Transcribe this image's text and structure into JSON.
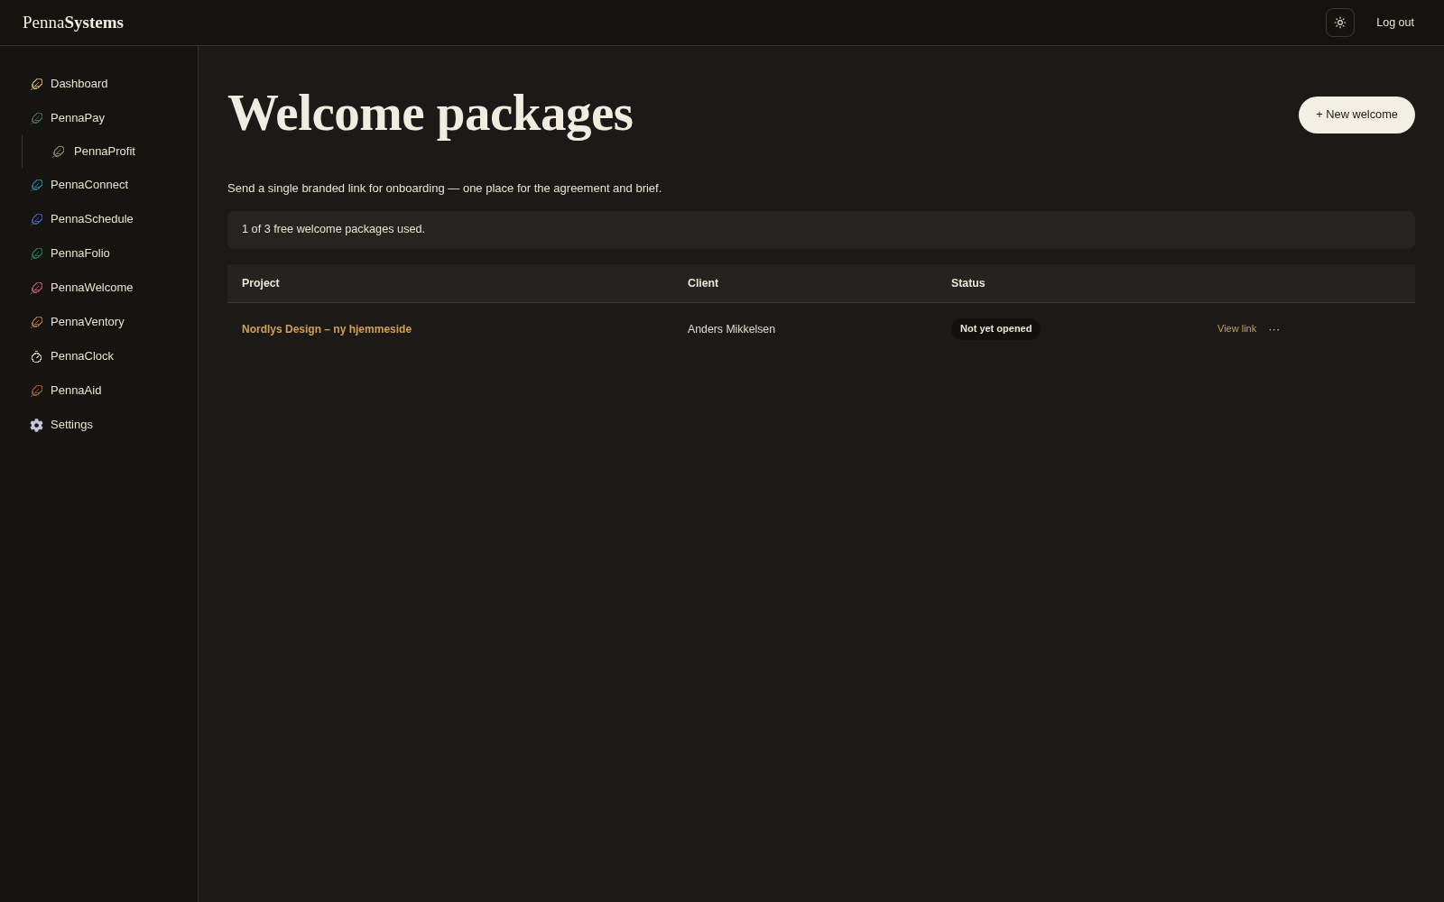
{
  "topbar": {
    "logo": "Penna**Systems**",
    "logout": "Log out"
  },
  "sidebar": {
    "items": [
      {
        "label": "Dashboard",
        "kind": "feather",
        "color": "#b8993c"
      },
      {
        "label": "PennaPay",
        "kind": "feather",
        "color": "#3f5c44",
        "children": [
          {
            "label": "PennaProfit",
            "kind": "feather",
            "color": "#76745a"
          }
        ]
      },
      {
        "label": "PennaConnect",
        "kind": "feather",
        "color": "#22717c"
      },
      {
        "label": "PennaSchedule",
        "kind": "feather",
        "color": "#3e519c"
      },
      {
        "label": "PennaFolio",
        "kind": "feather",
        "color": "#1f6b50"
      },
      {
        "label": "PennaWelcome",
        "kind": "feather",
        "color": "#a9466c"
      },
      {
        "label": "PennaVentory",
        "kind": "feather",
        "color": "#9b6a2f"
      },
      {
        "label": "PennaClock",
        "kind": "clock",
        "color": "#c8c19c"
      },
      {
        "label": "PennaAid",
        "kind": "feather",
        "color": "#a4462f"
      },
      {
        "label": "Settings",
        "kind": "gear",
        "color": "#c6c4da"
      }
    ]
  },
  "page": {
    "title": "Welcome packages",
    "new_button": "+ New welcome",
    "subtitle": "Send a single branded link for onboarding — one place for the agreement and brief.",
    "usage_notice": "1 of 3 free welcome packages used."
  },
  "table": {
    "columns": [
      "Project",
      "Client",
      "Status"
    ],
    "rows": [
      {
        "project": "Nordlys Design – ny hjemmeside",
        "client": "Anders Mikkelsen",
        "status": "Not yet opened",
        "view_link": "View link",
        "more": "···"
      }
    ]
  }
}
